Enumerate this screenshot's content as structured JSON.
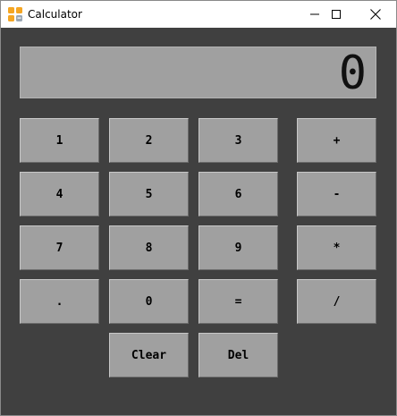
{
  "window": {
    "title": "Calculator"
  },
  "titlebar": {
    "buttons": [
      "minimize",
      "maximize",
      "close"
    ]
  },
  "display": {
    "value": "0"
  },
  "keys": {
    "k1": "1",
    "k2": "2",
    "k3": "3",
    "plus": "+",
    "k4": "4",
    "k5": "5",
    "k6": "6",
    "minus": "-",
    "k7": "7",
    "k8": "8",
    "k9": "9",
    "multiply": "*",
    "dot": ".",
    "k0": "0",
    "equals": "=",
    "divide": "/",
    "clear": "Clear",
    "del": "Del"
  },
  "colors": {
    "background": "#404040",
    "key": "#a0a0a0",
    "display": "#a0a0a0",
    "icon_orange": "#f5a623"
  }
}
